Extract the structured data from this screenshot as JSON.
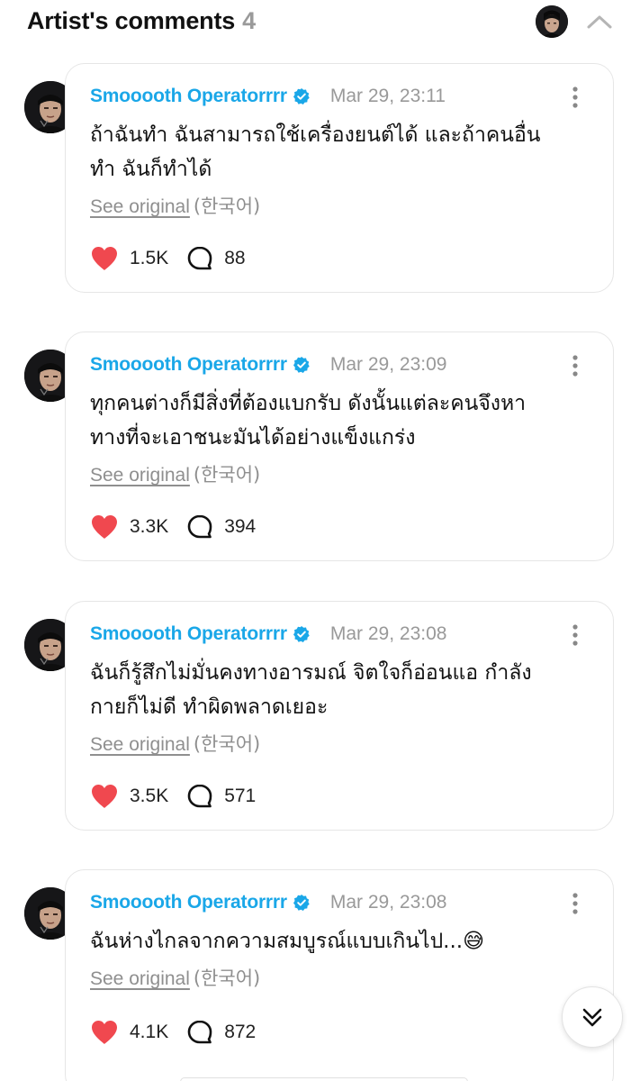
{
  "header": {
    "title": "Artist's comments",
    "count": "4"
  },
  "comments": [
    {
      "author": "Smooooth Operatorrrr",
      "time": "Mar 29, 23:11",
      "text_lines": [
        "ถ้าฉันทำ ฉันสามารถใช้เครื่องยนต์ได้ และถ้าคนอื่น",
        "ทำ ฉันก็ทำได้"
      ],
      "see_original": "See original",
      "language": "(한국어)",
      "likes": "1.5K",
      "replies": "88"
    },
    {
      "author": "Smooooth Operatorrrr",
      "time": "Mar 29, 23:09",
      "text_lines": [
        "ทุกคนต่างก็มีสิ่งที่ต้องแบกรับ ดังนั้นแต่ละคนจึงหา",
        "ทางที่จะเอาชนะมันได้อย่างแข็งแกร่ง"
      ],
      "see_original": "See original",
      "language": "(한국어)",
      "likes": "3.3K",
      "replies": "394"
    },
    {
      "author": "Smooooth Operatorrrr",
      "time": "Mar 29, 23:08",
      "text_lines": [
        "ฉันก็รู้สึกไม่มั่นคงทางอารมณ์ จิตใจก็อ่อนแอ กำลัง",
        "กายก็ไม่ดี ทำผิดพลาดเยอะ"
      ],
      "see_original": "See original",
      "language": "(한국어)",
      "likes": "3.5K",
      "replies": "571"
    },
    {
      "author": "Smooooth Operatorrrr",
      "time": "Mar 29, 23:08",
      "text_lines": [
        "ฉันห่างไกลจากความสมบูรณ์แบบเกินไป...😅"
      ],
      "see_original": "See original",
      "language": "(한국어)",
      "likes": "4.1K",
      "replies": "872"
    }
  ],
  "icons": {
    "verified": "verified-badge-icon",
    "more": "more-vertical-icon",
    "like": "heart-icon",
    "reply": "speech-bubble-icon",
    "collapse": "chevron-up-icon",
    "scroll": "double-chevron-down-icon"
  },
  "colors": {
    "author": "#1aa7e8",
    "heart": "#f0484f",
    "muted": "#999999"
  }
}
